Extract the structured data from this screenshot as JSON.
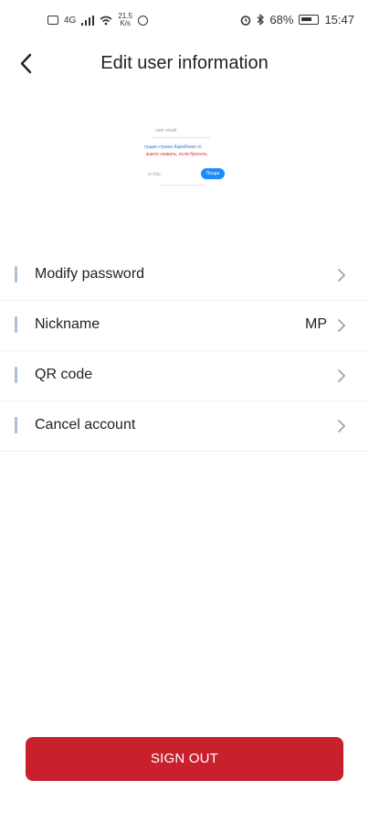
{
  "status_bar": {
    "net_speed_value": "21.5",
    "net_speed_unit": "K/s",
    "network_type": "4G",
    "battery": "68%",
    "time": "15:47"
  },
  "header": {
    "title": "Edit user information",
    "back_icon": "chevron-left-icon"
  },
  "preview": {
    "line1": "user email",
    "line2": "гущая страна Карибских го",
    "line3": "жаете назвать, если бросить",
    "input_placeholder": "Ie Alla",
    "button_label": "Понра"
  },
  "menu": {
    "items": [
      {
        "label": "Modify password",
        "value": ""
      },
      {
        "label": "Nickname",
        "value": "MP"
      },
      {
        "label": "QR code",
        "value": ""
      },
      {
        "label": "Cancel account",
        "value": ""
      }
    ],
    "accent_color": "#aebfd6"
  },
  "signout": {
    "label": "SIGN OUT",
    "color": "#c8202d"
  }
}
